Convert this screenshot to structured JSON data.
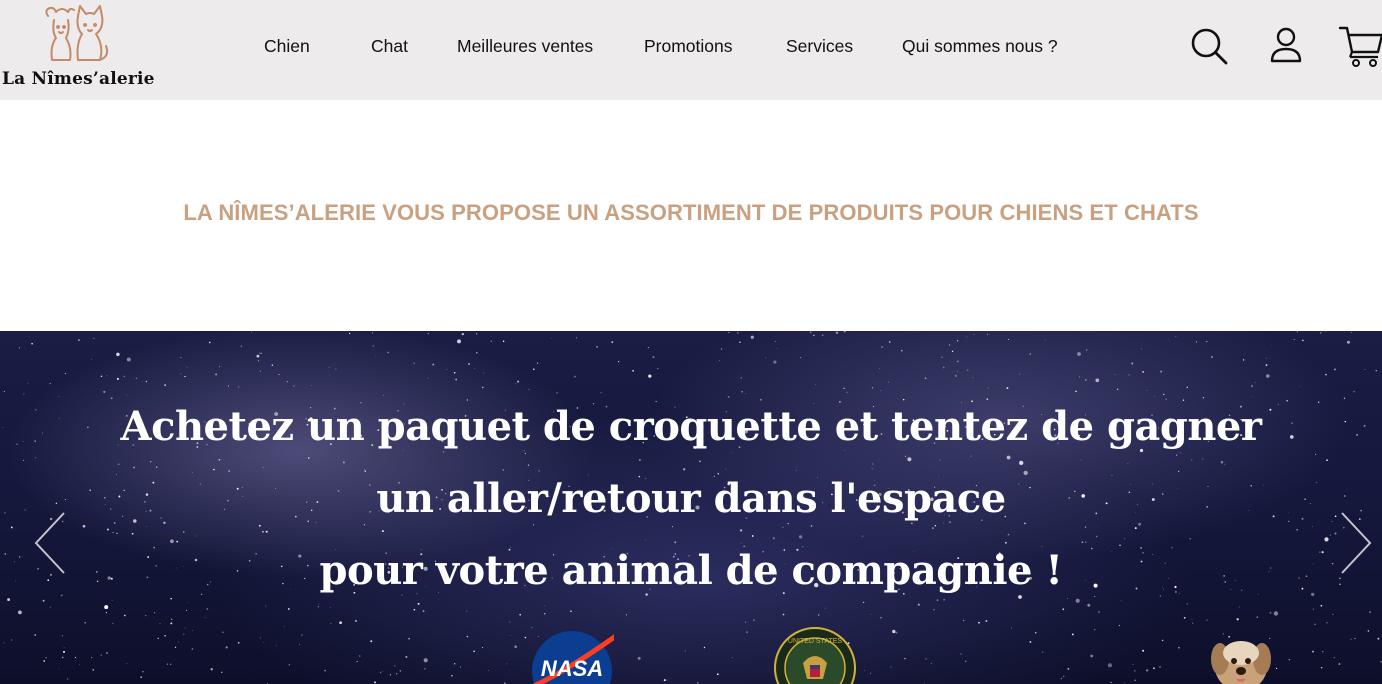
{
  "header": {
    "logo_text": "La Nîmes’alerie",
    "nav": [
      "Chien",
      "Chat",
      "Meilleures ventes",
      "Promotions",
      "Services",
      "Qui sommes nous ?"
    ],
    "icons": [
      "search-icon",
      "user-icon",
      "cart-icon"
    ]
  },
  "tagline": "LA NÎMES’ALERIE VOUS PROPOSE UN ASSORTIMENT DE PRODUITS POUR CHIENS ET CHATS",
  "hero": {
    "lines": [
      "Achetez un paquet de croquette et tentez de gagner",
      "un aller/retour dans l'espace",
      "pour votre animal de compagnie !"
    ],
    "badges": {
      "nasa": "NASA",
      "seal": "UNITED STATES"
    }
  },
  "colors": {
    "header_bg": "#edebeb",
    "accent": "#c9a080",
    "hero_text": "#ffffff",
    "logo_stroke": "#c48a6a"
  }
}
